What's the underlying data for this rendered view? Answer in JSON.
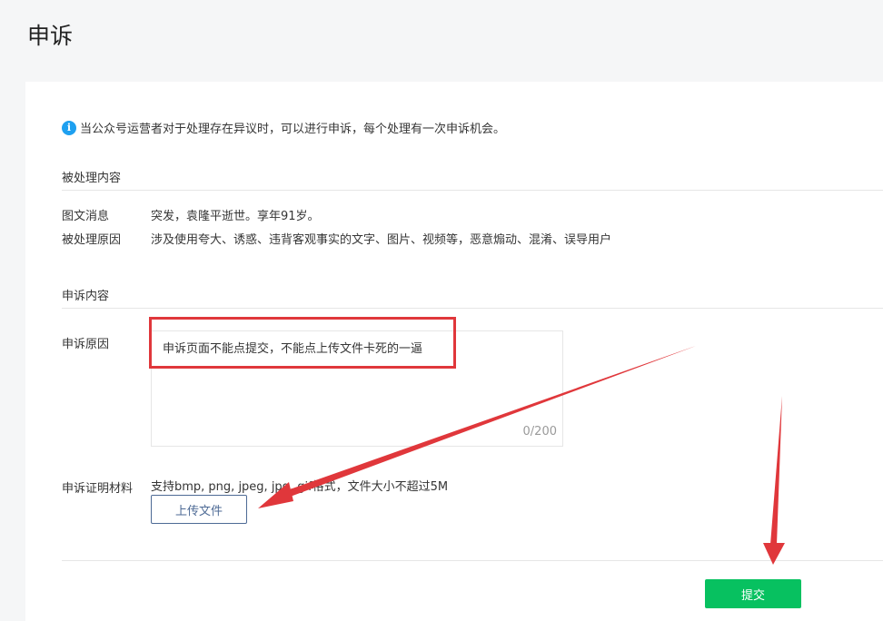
{
  "page": {
    "title": "申诉"
  },
  "notice": {
    "icon": "info-icon",
    "text": "当公众号运营者对于处理存在异议时，可以进行申诉，每个处理有一次申诉机会。"
  },
  "processed": {
    "heading": "被处理内容",
    "article_label": "图文消息",
    "article_value": "突发，袁隆平逝世。享年91岁。",
    "reason_label": "被处理原因",
    "reason_value": "涉及使用夸大、诱惑、违背客观事实的文字、图片、视频等，恶意煽动、混淆、误导用户"
  },
  "appeal": {
    "heading": "申诉内容",
    "reason_label": "申诉原因",
    "reason_text": "申诉页面不能点提交，不能点上传文件卡死的一逼",
    "counter": "0/200",
    "evidence_label": "申诉证明材料",
    "evidence_hint": "支持bmp, png, jpeg, jpg, gif格式，文件大小不超过5M",
    "upload_label": "上传文件"
  },
  "actions": {
    "submit_label": "提交"
  },
  "colors": {
    "annotation_red": "#e0373b",
    "submit_green": "#07c160",
    "info_blue": "#1ea0f0",
    "upload_border": "#4d6a95"
  }
}
